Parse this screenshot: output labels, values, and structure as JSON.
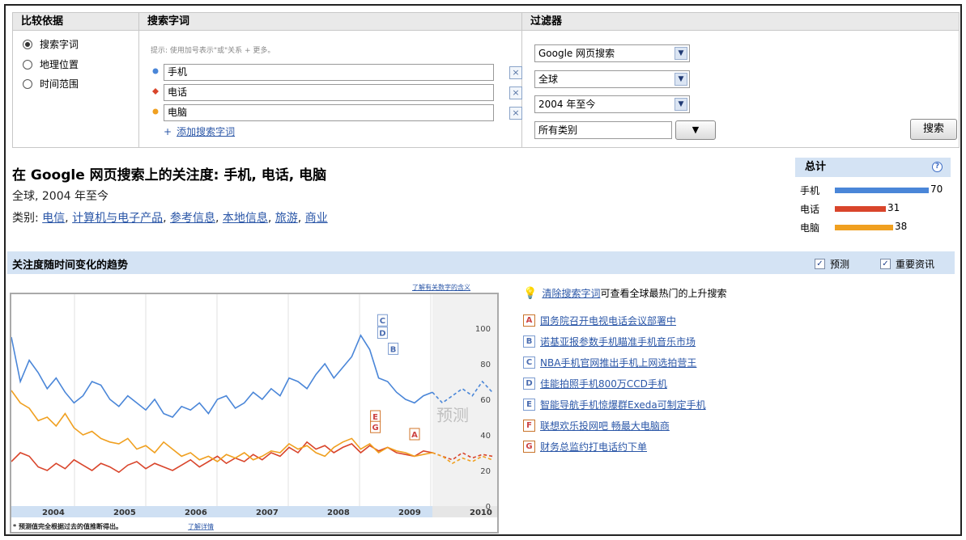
{
  "compare": {
    "header": "比较依据",
    "options": [
      {
        "label": "搜索字词",
        "selected": true
      },
      {
        "label": "地理位置",
        "selected": false
      },
      {
        "label": "时间范围",
        "selected": false
      }
    ]
  },
  "terms": {
    "header": "搜索字词",
    "hint": "提示: 使用加号表示\"或\"关系 + 更多。",
    "items": [
      {
        "value": "手机",
        "color": "#4a86d8"
      },
      {
        "value": "电话",
        "color": "#d9452b"
      },
      {
        "value": "电脑",
        "color": "#f0a020"
      }
    ],
    "remove_symbol": "×",
    "add_link": "添加搜索字词",
    "add_prefix": "+"
  },
  "filters": {
    "header": "过滤器",
    "search_type": "Google 网页搜索",
    "region": "全球",
    "time": "2004 年至今",
    "category": "所有类别",
    "search_button": "搜索"
  },
  "result": {
    "title": "在 Google 网页搜索上的关注度: 手机, 电话, 电脑",
    "subtitle": "全球, 2004 年至今",
    "category_prefix": "类别:",
    "categories": [
      "电信",
      "计算机与电子产品",
      "参考信息",
      "本地信息",
      "旅游",
      "商业"
    ]
  },
  "totals": {
    "header": "总计",
    "help": "?",
    "rows": [
      {
        "label": "手机",
        "value": 70,
        "color": "#4a86d8"
      },
      {
        "label": "电话",
        "value": 31,
        "color": "#d9452b"
      },
      {
        "label": "电脑",
        "value": 38,
        "color": "#f0a020"
      }
    ]
  },
  "trend": {
    "title": "关注度随时间变化的趋势",
    "forecast_label": "预测",
    "news_label": "重要资讯"
  },
  "chart_data": {
    "type": "line",
    "x": [
      "2004",
      "2005",
      "2006",
      "2007",
      "2008",
      "2009",
      "2010"
    ],
    "ylim": [
      0,
      110
    ],
    "yticks": [
      0,
      20,
      40,
      60,
      80,
      100
    ],
    "forecast_text": "预测",
    "top_link": "了解有关数字的含义",
    "footnote": "* 预测值完全根据过去的值推断得出。",
    "footnote_link": "了解详情",
    "markers": [
      {
        "letter": "A",
        "x": 2009.0,
        "y": 40
      },
      {
        "letter": "B",
        "x": 2008.7,
        "y": 88
      },
      {
        "letter": "C",
        "x": 2008.55,
        "y": 104
      },
      {
        "letter": "D",
        "x": 2008.55,
        "y": 97
      },
      {
        "letter": "E",
        "x": 2008.45,
        "y": 50
      },
      {
        "letter": "G",
        "x": 2008.45,
        "y": 44
      }
    ],
    "series": [
      {
        "name": "手机",
        "color": "#4a86d8",
        "values": [
          95,
          70,
          82,
          75,
          66,
          72,
          64,
          58,
          62,
          70,
          68,
          60,
          56,
          62,
          58,
          54,
          60,
          52,
          50,
          56,
          54,
          58,
          52,
          60,
          62,
          55,
          58,
          64,
          60,
          66,
          62,
          72,
          70,
          66,
          74,
          80,
          72,
          78,
          84,
          96,
          88,
          72,
          70,
          64,
          60,
          58,
          62,
          64
        ]
      },
      {
        "name": "电话",
        "color": "#d9452b",
        "values": [
          25,
          30,
          28,
          22,
          20,
          24,
          21,
          26,
          23,
          20,
          24,
          22,
          19,
          23,
          25,
          21,
          24,
          22,
          20,
          23,
          26,
          22,
          25,
          28,
          24,
          27,
          25,
          29,
          26,
          30,
          28,
          33,
          30,
          36,
          32,
          34,
          30,
          33,
          35,
          30,
          34,
          31,
          33,
          30,
          29,
          28,
          31,
          30
        ]
      },
      {
        "name": "电脑",
        "color": "#f0a020",
        "values": [
          65,
          58,
          55,
          48,
          50,
          45,
          52,
          44,
          40,
          42,
          38,
          36,
          35,
          38,
          32,
          34,
          30,
          36,
          32,
          28,
          30,
          26,
          28,
          25,
          29,
          27,
          30,
          26,
          28,
          31,
          30,
          35,
          32,
          34,
          30,
          28,
          33,
          36,
          38,
          32,
          35,
          30,
          33,
          31,
          30,
          28,
          29,
          30
        ]
      }
    ],
    "forecast": [
      {
        "name": "手机",
        "values": [
          58,
          62,
          66,
          62,
          70,
          64
        ]
      },
      {
        "name": "电话",
        "values": [
          28,
          26,
          30,
          27,
          29,
          28
        ]
      },
      {
        "name": "电脑",
        "values": [
          28,
          24,
          27,
          25,
          28,
          26
        ]
      }
    ]
  },
  "news": {
    "head_link": "清除搜索字词",
    "head_text": "可查看全球最热门的上升搜索",
    "items": [
      {
        "letter": "A",
        "text": "国务院召开电视电话会议部署中",
        "style": "orange"
      },
      {
        "letter": "B",
        "text": "诺基亚报参数手机瞄准手机音乐市场",
        "style": "blue"
      },
      {
        "letter": "C",
        "text": "NBA手机官网推出手机上网选拍营王",
        "style": "blue"
      },
      {
        "letter": "D",
        "text": "佳能拍照手机800万CCD手机",
        "style": "blue"
      },
      {
        "letter": "E",
        "text": "智能导航手机惊爆群Exeda可制定手机",
        "style": "blue"
      },
      {
        "letter": "F",
        "text": "联想欢乐投网吧 畅最大电脑商",
        "style": "orange"
      },
      {
        "letter": "G",
        "text": "财务总监约打电话约下单",
        "style": "orange"
      }
    ]
  }
}
